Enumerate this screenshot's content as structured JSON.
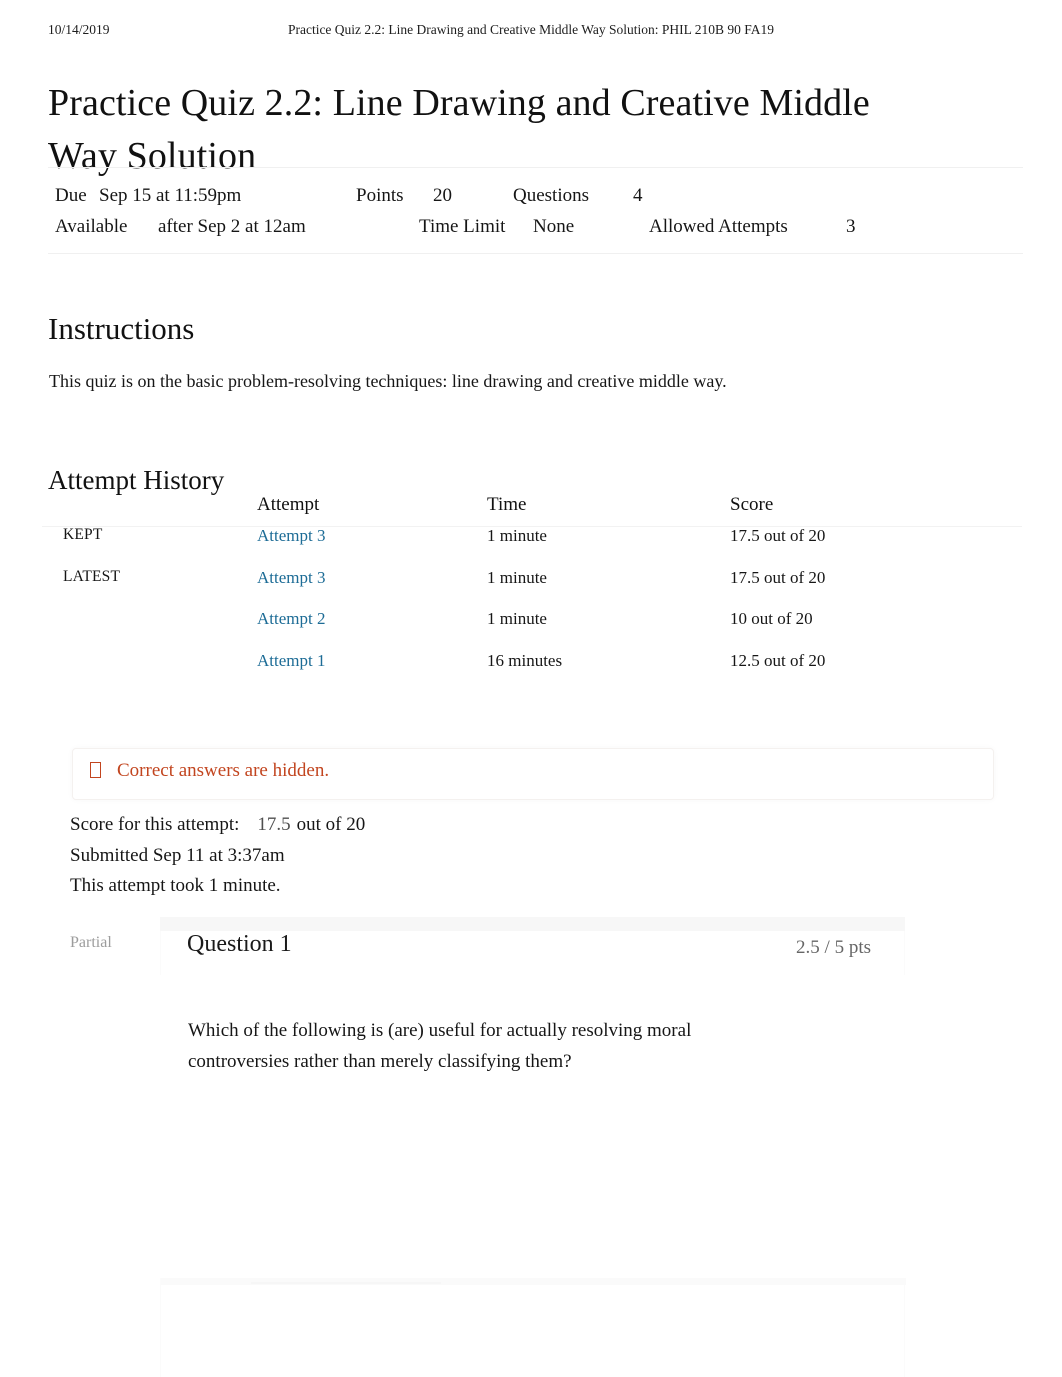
{
  "print_header": {
    "date": "10/14/2019",
    "title": "Practice Quiz 2.2: Line Drawing and Creative Middle Way Solution: PHIL 210B 90 FA19"
  },
  "quiz": {
    "title": "Practice Quiz 2.2: Line Drawing and Creative Middle Way Solution"
  },
  "meta": {
    "due_label": "Due",
    "due_value": "Sep 15 at 11:59pm",
    "points_label": "Points",
    "points_value": "20",
    "questions_label": "Questions",
    "questions_value": "4",
    "available_label": "Available",
    "available_value": "after Sep 2 at 12am",
    "time_limit_label": "Time Limit",
    "time_limit_value": "None",
    "allowed_attempts_label": "Allowed Attempts",
    "allowed_attempts_value": "3"
  },
  "instructions": {
    "heading": "Instructions",
    "body": "This quiz is on the basic problem-resolving techniques: line drawing and creative middle way."
  },
  "attempt_history": {
    "heading": "Attempt History",
    "columns": {
      "flag": "",
      "attempt": "Attempt",
      "time": "Time",
      "score": "Score"
    },
    "rows": [
      {
        "flag": "KEPT",
        "attempt": "Attempt 3",
        "time": "1 minute",
        "score": "17.5 out of 20"
      },
      {
        "flag": "LATEST",
        "attempt": "Attempt 3",
        "time": "1 minute",
        "score": "17.5 out of 20"
      },
      {
        "flag": "",
        "attempt": "Attempt 2",
        "time": "1 minute",
        "score": "10 out of 20"
      },
      {
        "flag": "",
        "attempt": "Attempt 1",
        "time": "16 minutes",
        "score": "12.5 out of 20"
      }
    ]
  },
  "notice": {
    "icon": "warning-box-icon",
    "text": "Correct answers are hidden."
  },
  "attempt_summary": {
    "score_label": "Score for this attempt:",
    "score_value": "17.5",
    "score_suffix": "out of 20",
    "submitted": "Submitted Sep 11 at 3:37am",
    "duration": "This attempt took 1 minute."
  },
  "question": {
    "status": "Partial",
    "title": "Question 1",
    "points": "2.5 / 5 pts",
    "text": "Which of the following is (are) useful for actually resolving moral controversies rather than merely classifying them?"
  },
  "colors": {
    "link": "#1d6c96",
    "notice": "#c2451f",
    "muted": "#9c9c9c",
    "text": "#161616"
  }
}
